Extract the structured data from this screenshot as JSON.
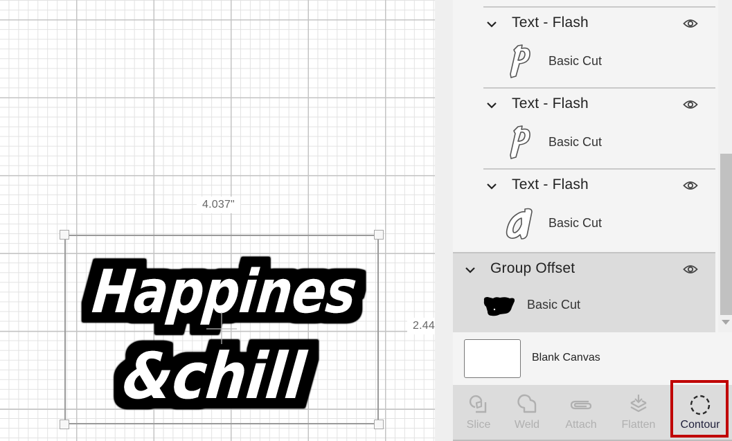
{
  "canvas": {
    "width_label": "4.037\"",
    "height_label": "2.44",
    "design": {
      "line1": "Happines",
      "line2": "&chill",
      "fill_color": "#ffffff",
      "offset_color": "#000000"
    }
  },
  "layers": {
    "items": [
      {
        "title": "Text - Flash",
        "child_label": "Basic Cut",
        "thumb_icon": "letter-p-outline-icon",
        "thumb_glyph": "p"
      },
      {
        "title": "Text - Flash",
        "child_label": "Basic Cut",
        "thumb_icon": "letter-p-outline-icon",
        "thumb_glyph": "p"
      },
      {
        "title": "Text - Flash",
        "child_label": "Basic Cut",
        "thumb_icon": "letter-a-outline-icon",
        "thumb_glyph": "a"
      }
    ],
    "group": {
      "title": "Group Offset",
      "child_label": "Basic Cut",
      "thumb_icon": "offset-silhouette-icon"
    },
    "blank_canvas": {
      "label": "Blank Canvas"
    }
  },
  "toolbar": {
    "tools": [
      {
        "label": "Slice",
        "icon": "slice-icon",
        "enabled": false
      },
      {
        "label": "Weld",
        "icon": "weld-icon",
        "enabled": false
      },
      {
        "label": "Attach",
        "icon": "attach-icon",
        "enabled": false
      },
      {
        "label": "Flatten",
        "icon": "flatten-icon",
        "enabled": false
      },
      {
        "label": "Contour",
        "icon": "contour-icon",
        "enabled": true,
        "highlighted": true
      }
    ],
    "highlight_color": "#c00000"
  }
}
